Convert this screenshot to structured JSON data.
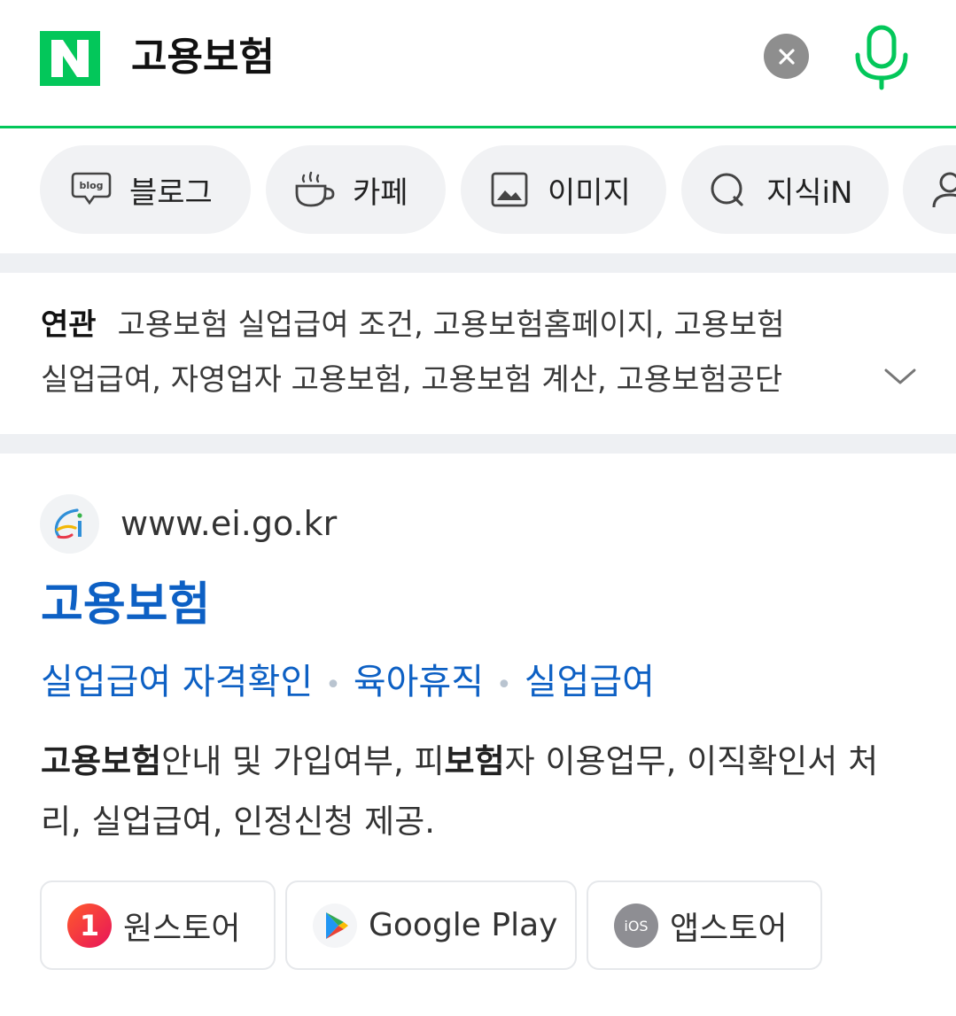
{
  "search": {
    "query": "고용보험"
  },
  "tabs": [
    {
      "label": "블로그",
      "icon": "blog-icon"
    },
    {
      "label": "카페",
      "icon": "cafe-cup-icon"
    },
    {
      "label": "이미지",
      "icon": "image-icon"
    },
    {
      "label": "지식iN",
      "icon": "question-icon"
    },
    {
      "label": "",
      "icon": "person-icon"
    }
  ],
  "related": {
    "label": "연관",
    "line1": "고용보험 실업급여 조건, 고용보험홈페이지, 고용보험",
    "line2": "실업급여, 자영업자 고용보험, 고용보험 계산, 고용보험공단"
  },
  "result": {
    "site_url": "www.ei.go.kr",
    "title": "고용보험",
    "sublinks": [
      "실업급여 자격확인",
      "육아휴직",
      "실업급여"
    ],
    "desc": {
      "b1": "고용보험",
      "t1": "안내 및 가입여부, 피",
      "b2": "보험",
      "t2": "자 이용업무, 이직확인서 처리, 실업급여, 인정신청 제공."
    },
    "apps": [
      {
        "label": "원스토어",
        "icon": "onestore-icon",
        "icon_text": "1"
      },
      {
        "label": "Google Play",
        "icon": "google-play-icon"
      },
      {
        "label": "앱스토어",
        "icon": "ios-icon",
        "icon_text": "iOS"
      }
    ]
  },
  "colors": {
    "brand_green": "#03c75a",
    "link_blue": "#0d60c4",
    "tab_bg": "#f1f2f4"
  }
}
